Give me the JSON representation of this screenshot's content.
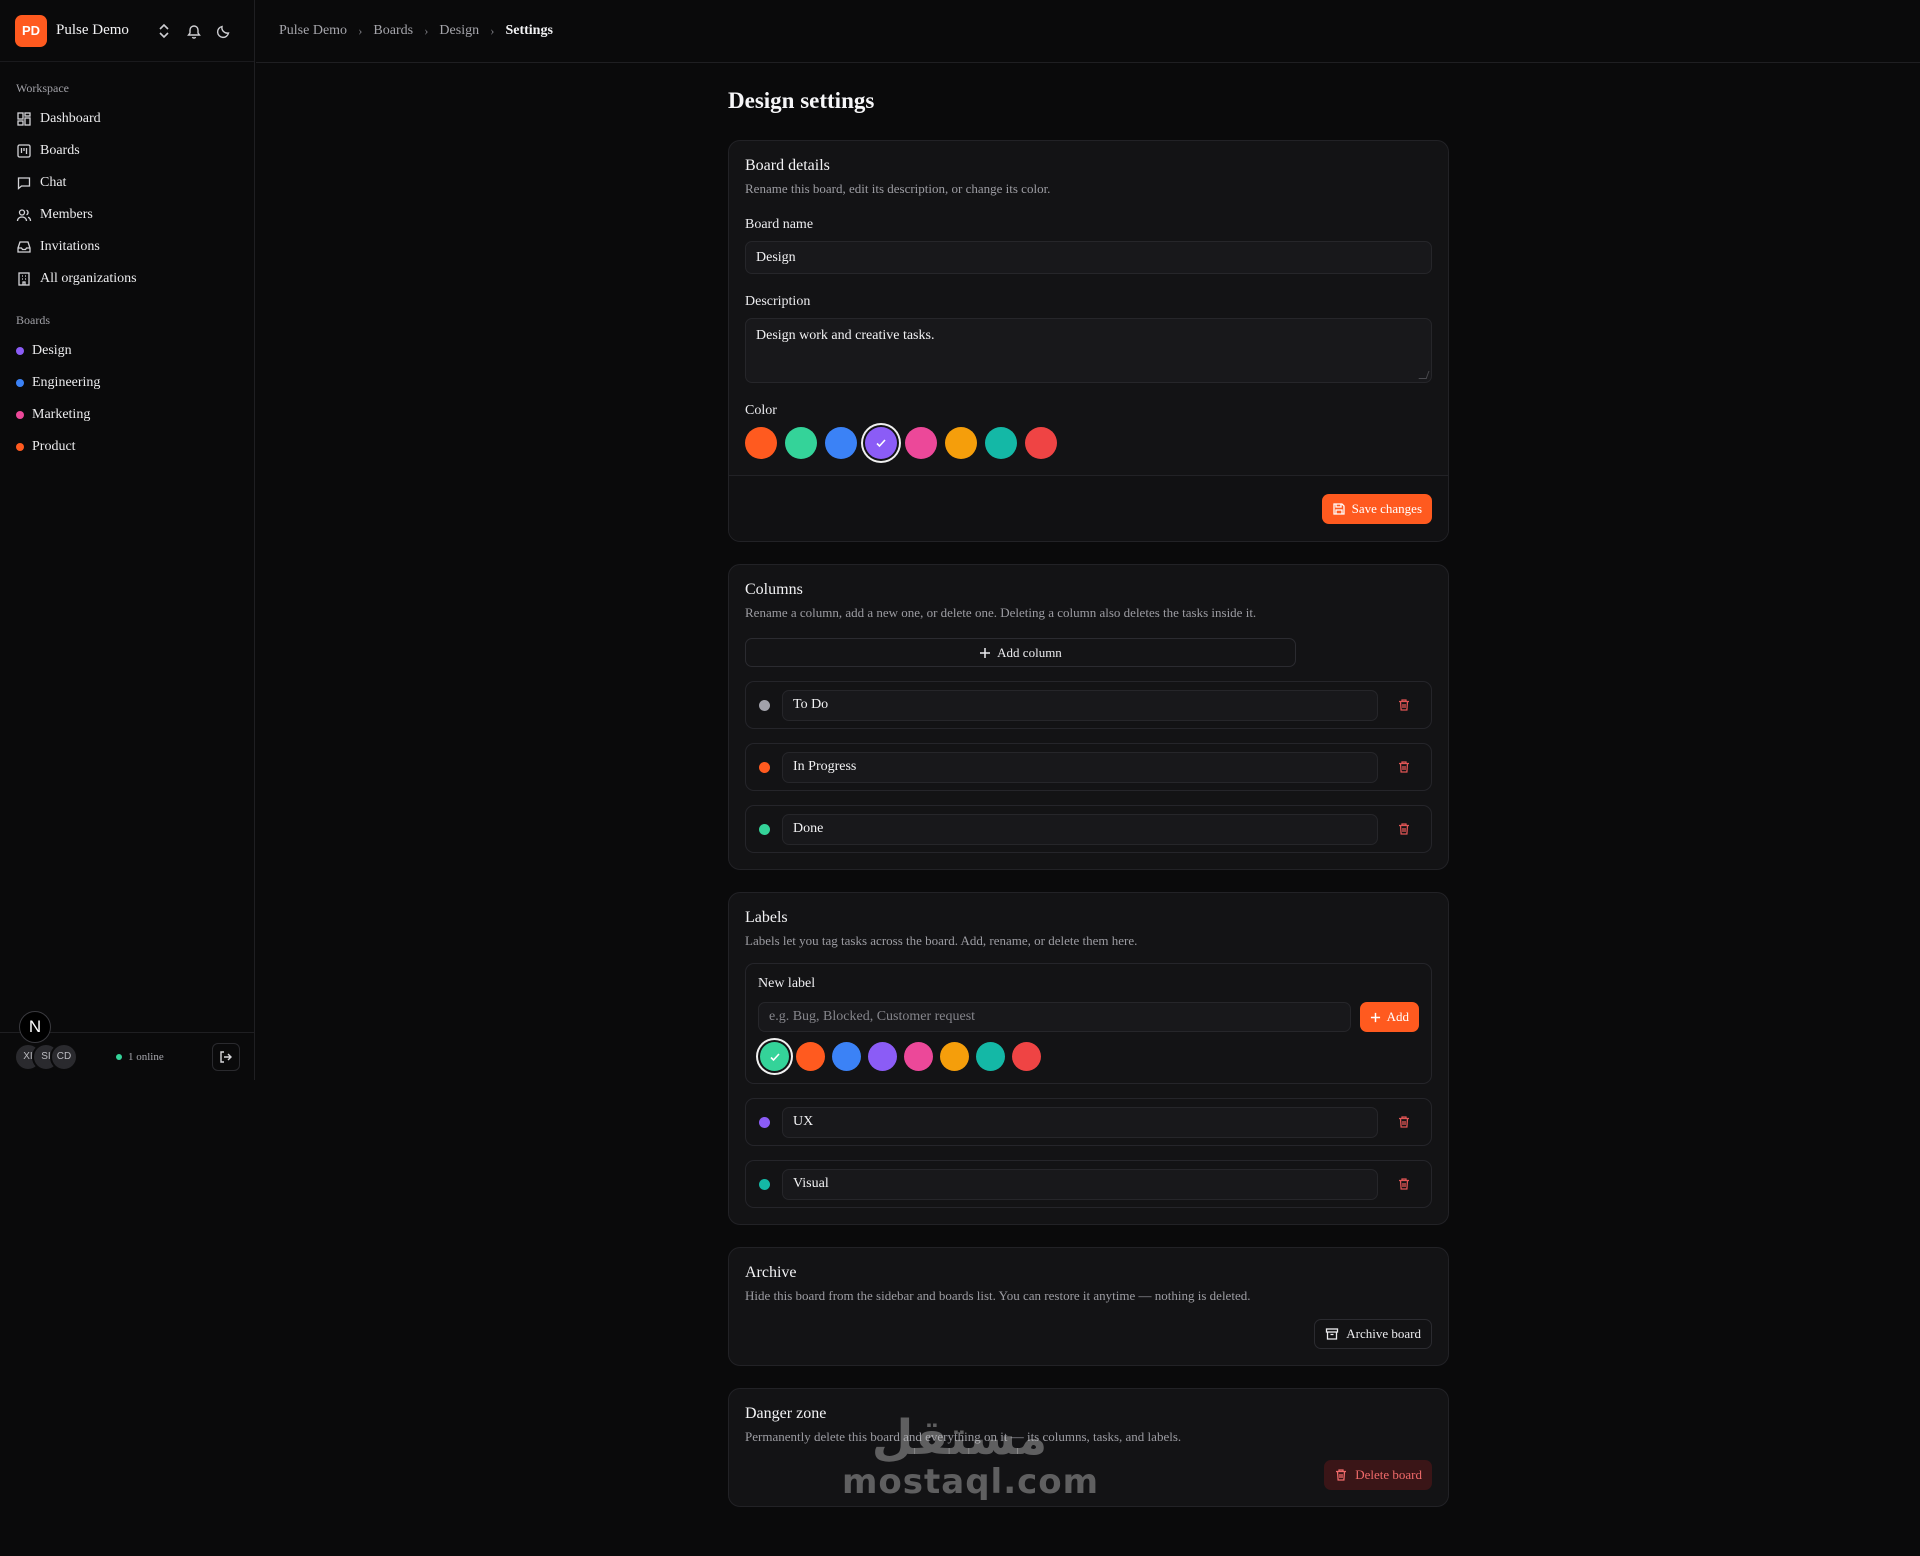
{
  "org": {
    "initials": "PD",
    "name": "Pulse Demo"
  },
  "sidebar": {
    "workspace_heading": "Workspace",
    "workspace_items": [
      {
        "label": "Dashboard",
        "icon": "dashboard-icon"
      },
      {
        "label": "Boards",
        "icon": "board-icon"
      },
      {
        "label": "Chat",
        "icon": "chat-icon"
      },
      {
        "label": "Members",
        "icon": "members-icon"
      },
      {
        "label": "Invitations",
        "icon": "inbox-icon"
      },
      {
        "label": "All organizations",
        "icon": "building-icon"
      }
    ],
    "boards_heading": "Boards",
    "boards": [
      {
        "label": "Design",
        "color": "#8b5cf6"
      },
      {
        "label": "Engineering",
        "color": "#3b82f6"
      },
      {
        "label": "Marketing",
        "color": "#ec4899"
      },
      {
        "label": "Product",
        "color": "#ff5a1f"
      }
    ],
    "footer": {
      "avatars": [
        "XI",
        "SI",
        "CD"
      ],
      "badge": "N",
      "online": "1 online"
    }
  },
  "breadcrumb": [
    "Pulse Demo",
    "Boards",
    "Design",
    "Settings"
  ],
  "page_title": "Design settings",
  "board_details": {
    "title": "Board details",
    "description": "Rename this board, edit its description, or change its color.",
    "name_label": "Board name",
    "name_value": "Design",
    "desc_label": "Description",
    "desc_value": "Design work and creative tasks.",
    "color_label": "Color",
    "colors": [
      "#ff5a1f",
      "#34d399",
      "#3b82f6",
      "#8b5cf6",
      "#ec4899",
      "#f59e0b",
      "#14b8a6",
      "#ef4444"
    ],
    "selected_color": "#8b5cf6",
    "save_label": "Save changes"
  },
  "columns": {
    "title": "Columns",
    "description": "Rename a column, add a new one, or delete one. Deleting a column also deletes the tasks inside it.",
    "add_label": "Add column",
    "items": [
      {
        "name": "To Do",
        "color": "#a1a1aa"
      },
      {
        "name": "In Progress",
        "color": "#ff5a1f"
      },
      {
        "name": "Done",
        "color": "#34d399"
      }
    ]
  },
  "labels": {
    "title": "Labels",
    "description": "Labels let you tag tasks across the board. Add, rename, or delete them here.",
    "new_label_heading": "New label",
    "new_label_placeholder": "e.g. Bug, Blocked, Customer request",
    "add_label": "Add",
    "colors": [
      "#34d399",
      "#ff5a1f",
      "#3b82f6",
      "#8b5cf6",
      "#ec4899",
      "#f59e0b",
      "#14b8a6",
      "#ef4444"
    ],
    "selected_color": "#34d399",
    "items": [
      {
        "name": "UX",
        "color": "#8b5cf6"
      },
      {
        "name": "Visual",
        "color": "#14b8a6"
      }
    ]
  },
  "archive": {
    "title": "Archive",
    "description": "Hide this board from the sidebar and boards list. You can restore it anytime — nothing is deleted.",
    "button": "Archive board"
  },
  "danger": {
    "title": "Danger zone",
    "description": "Permanently delete this board and everything on it — its columns, tasks, and labels.",
    "button": "Delete board"
  },
  "watermark": {
    "arabic": "مستقل",
    "latin": "mostaql.com"
  }
}
